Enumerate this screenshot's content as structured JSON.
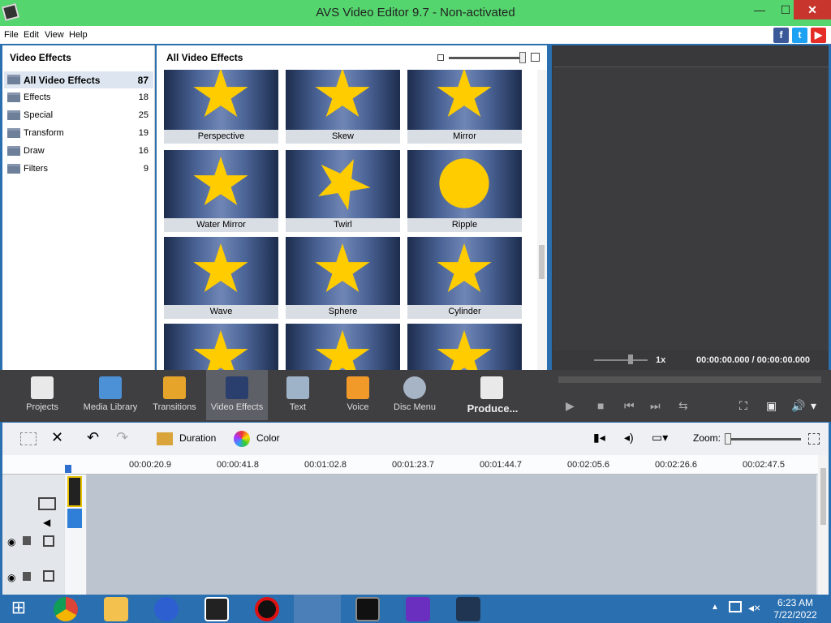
{
  "window": {
    "title": "AVS Video Editor 9.7 - Non-activated",
    "minimize": "—",
    "maximize": "☐",
    "close": "✕"
  },
  "menu": [
    "File",
    "Edit",
    "View",
    "Help"
  ],
  "social": [
    {
      "icon": "facebook-icon",
      "glyph": "f",
      "color": "#3b5998"
    },
    {
      "icon": "twitter-icon",
      "glyph": "t",
      "color": "#1da1f2"
    },
    {
      "icon": "youtube-icon",
      "glyph": "▶",
      "color": "#e52d27"
    }
  ],
  "left_panel": {
    "header": "Video Effects",
    "categories": [
      {
        "name": "All Video Effects",
        "count": "87",
        "selected": true
      },
      {
        "name": "Effects",
        "count": "18"
      },
      {
        "name": "Special",
        "count": "25"
      },
      {
        "name": "Transform",
        "count": "19"
      },
      {
        "name": "Draw",
        "count": "16"
      },
      {
        "name": "Filters",
        "count": "9"
      }
    ]
  },
  "effects_panel": {
    "header": "All Video Effects",
    "effects": [
      "Perspective",
      "Skew",
      "Mirror",
      "Water Mirror",
      "Twirl",
      "Ripple",
      "Wave",
      "Sphere",
      "Cylinder",
      "",
      "",
      ""
    ]
  },
  "preview": {
    "speed": "1x",
    "timecode": "00:00:00.000  /  00:00:00.000"
  },
  "toolbar": {
    "tools": [
      {
        "label": "Projects",
        "icon": "clapperboard-icon",
        "color": "#e9e9e9"
      },
      {
        "label": "Media Library",
        "icon": "film-icon",
        "color": "#4c90d6"
      },
      {
        "label": "Transitions",
        "icon": "transitions-icon",
        "color": "#e6a52a"
      },
      {
        "label": "Video Effects",
        "icon": "star-effect-icon",
        "color": "#2a3f6e",
        "active": true
      },
      {
        "label": "Text",
        "icon": "text-icon",
        "color": "#9fb3c8"
      },
      {
        "label": "Voice",
        "icon": "microphone-icon",
        "color": "#f19a2a"
      },
      {
        "label": "Disc Menu",
        "icon": "disc-icon",
        "color": "#a7b4c5"
      },
      {
        "label": "Produce...",
        "icon": "produce-icon",
        "color": "#e9e9e9"
      }
    ],
    "controls": [
      "▶",
      "■",
      "⏮",
      "⏭",
      "⇆",
      "⛶",
      "▣",
      "🔊",
      "▾"
    ]
  },
  "edit_toolbar": {
    "duration_label": "Duration",
    "color_label": "Color",
    "zoom_label": "Zoom:"
  },
  "timeline": {
    "ticks": [
      "00:00:20.9",
      "00:00:41.8",
      "00:01:02.8",
      "00:01:23.7",
      "00:01:44.7",
      "00:02:05.6",
      "00:02:26.6",
      "00:02:47.5"
    ]
  },
  "taskbar": {
    "time": "6:23 AM",
    "date": "7/22/2022",
    "apps": [
      {
        "icon": "windows-start-icon",
        "color": "#ffffff"
      },
      {
        "icon": "chrome-icon",
        "color": "#e6b400"
      },
      {
        "icon": "file-explorer-icon",
        "color": "#f2c14e"
      },
      {
        "icon": "headphones-app-icon",
        "color": "#2d5fd1"
      },
      {
        "icon": "il-app-icon",
        "color": "#222222"
      },
      {
        "icon": "record-app-icon",
        "color": "#d11"
      },
      {
        "icon": "avs-editor-icon",
        "color": "#555"
      },
      {
        "icon": "star-film-icon",
        "color": "#111"
      },
      {
        "icon": "y-app-icon",
        "color": "#6a2fbf"
      },
      {
        "icon": "filmora-icon",
        "color": "#1f3552"
      }
    ]
  }
}
